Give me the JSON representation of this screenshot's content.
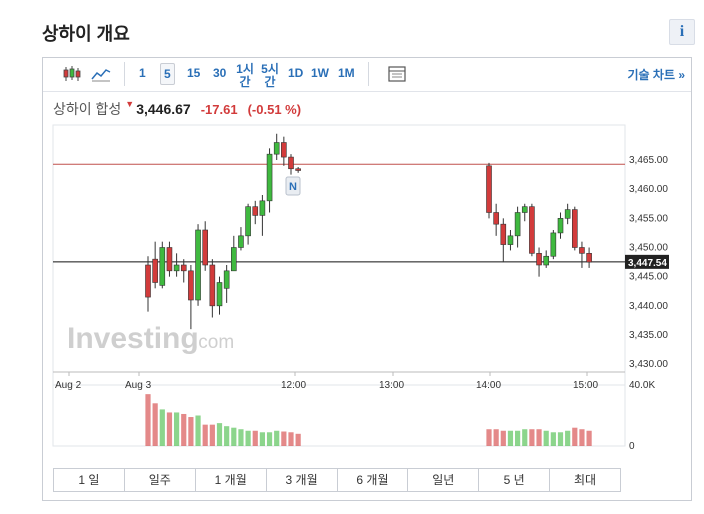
{
  "header": {
    "title": "상하이 개요",
    "info_icon": "i"
  },
  "toolbar": {
    "intervals": [
      "1",
      "5",
      "15",
      "30",
      "1시\n간",
      "5시\n간",
      "1D",
      "1W",
      "1M"
    ],
    "active_interval": "5",
    "right_link": "기술 차트 »",
    "icons": [
      "candlestick-icon",
      "area-chart-icon",
      "table-icon"
    ]
  },
  "quote": {
    "name": "상하이 합성",
    "direction_icon": "down-arrow-icon",
    "price": "3,446.67",
    "change": "-17.61",
    "change_pct": "(-0.51 %)"
  },
  "colors": {
    "up": "#3fb93f",
    "down": "#d23b3b",
    "accent": "#2a6fb7"
  },
  "ranges": [
    "1 일",
    "일주",
    "1 개월",
    "3 개월",
    "6 개월",
    "일년",
    "5 년",
    "최대"
  ],
  "chart_data": {
    "type": "candlestick",
    "x_ticks": [
      "Aug 2",
      "Aug 3",
      "12:00",
      "13:00",
      "14:00",
      "15:00"
    ],
    "y_ticks": [
      3430,
      3435,
      3440,
      3445,
      3450,
      3455,
      3460,
      3465
    ],
    "y_tick_labels": [
      "3,430.00",
      "3,435.00",
      "3,440.00",
      "3,445.00",
      "3,450.00",
      "3,455.00",
      "3,460.00",
      "3,465.00"
    ],
    "ylim": [
      3429,
      3471
    ],
    "previous_close_line": 3464.28,
    "current_price_label": "3,447.54",
    "current_price": 3447.54,
    "news_marker": "N",
    "volume_ticks": [
      "40.0K",
      "0"
    ],
    "volume_max": 40000,
    "watermark": "Investing.com",
    "segments": [
      {
        "candles": [
          [
            3447.0,
            3441.5,
            3448.5,
            3439.0
          ],
          [
            3448.0,
            3444.0,
            3451.0,
            3443.0
          ],
          [
            3443.5,
            3450.0,
            3451.0,
            3443.0
          ],
          [
            3450.0,
            3446.0,
            3451.0,
            3445.0
          ],
          [
            3446.0,
            3447.0,
            3449.0,
            3445.0
          ],
          [
            3447.0,
            3446.0,
            3448.0,
            3444.0
          ],
          [
            3446.0,
            3441.0,
            3447.0,
            3436.0
          ],
          [
            3441.0,
            3453.0,
            3454.0,
            3440.0
          ],
          [
            3453.0,
            3447.0,
            3454.5,
            3446.0
          ],
          [
            3447.0,
            3440.0,
            3448.0,
            3438.0
          ],
          [
            3440.0,
            3444.0,
            3445.0,
            3438.5
          ],
          [
            3443.0,
            3446.0,
            3447.0,
            3440.5
          ],
          [
            3446.0,
            3450.0,
            3452.0,
            3446.0
          ],
          [
            3450.0,
            3452.0,
            3453.5,
            3449.5
          ],
          [
            3452.0,
            3457.0,
            3457.5,
            3450.5
          ],
          [
            3457.0,
            3455.5,
            3458.0,
            3454.0
          ],
          [
            3455.5,
            3458.0,
            3459.0,
            3452.0
          ],
          [
            3458.0,
            3466.0,
            3467.0,
            3456.0
          ],
          [
            3466.0,
            3468.0,
            3469.5,
            3465.0
          ],
          [
            3468.0,
            3465.5,
            3469.0,
            3464.0
          ],
          [
            3465.5,
            3463.5,
            3466.0,
            3462.5
          ],
          [
            3463.5,
            3463.2,
            3463.8,
            3462.8
          ]
        ],
        "volumes": [
          34000,
          28000,
          24000,
          22000,
          22000,
          21000,
          19000,
          20000,
          14000,
          14000,
          15000,
          13000,
          12000,
          11000,
          10000,
          10000,
          9000,
          9000,
          10000,
          9500,
          9000,
          8000
        ]
      },
      {
        "candles": [
          [
            3464.0,
            3456.0,
            3464.5,
            3455.0
          ],
          [
            3456.0,
            3454.0,
            3457.5,
            3452.0
          ],
          [
            3454.0,
            3450.5,
            3455.0,
            3447.5
          ],
          [
            3450.5,
            3452.0,
            3453.0,
            3449.5
          ],
          [
            3452.0,
            3456.0,
            3457.0,
            3450.0
          ],
          [
            3456.0,
            3457.0,
            3457.5,
            3454.5
          ],
          [
            3457.0,
            3449.0,
            3457.5,
            3448.5
          ],
          [
            3449.0,
            3447.0,
            3450.0,
            3445.0
          ],
          [
            3447.0,
            3448.5,
            3449.5,
            3446.5
          ],
          [
            3448.5,
            3452.5,
            3453.0,
            3448.0
          ],
          [
            3452.5,
            3455.0,
            3456.0,
            3451.5
          ],
          [
            3455.0,
            3456.5,
            3457.5,
            3454.0
          ],
          [
            3456.5,
            3450.0,
            3457.0,
            3449.5
          ],
          [
            3450.0,
            3449.0,
            3451.0,
            3446.5
          ],
          [
            3449.0,
            3447.5,
            3450.0,
            3446.5
          ]
        ],
        "volumes": [
          11000,
          11000,
          10000,
          10000,
          10000,
          11000,
          11000,
          11000,
          10000,
          9000,
          9000,
          10000,
          12000,
          11000,
          10000
        ]
      }
    ]
  }
}
